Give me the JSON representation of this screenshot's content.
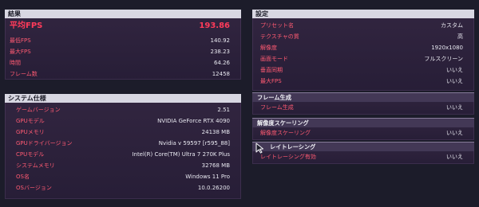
{
  "results": {
    "header": "結果",
    "avg_label": "平均FPS",
    "avg_value": "193.86",
    "rows": [
      {
        "label": "最低FPS",
        "value": "140.92"
      },
      {
        "label": "最大FPS",
        "value": "238.23"
      },
      {
        "label": "時間",
        "value": "64.26"
      },
      {
        "label": "フレーム数",
        "value": "12458"
      }
    ]
  },
  "system": {
    "header": "システム仕様",
    "rows": [
      {
        "label": "ゲームバージョン",
        "value": "2.51"
      },
      {
        "label": "GPUモデル",
        "value": "NVIDIA GeForce RTX 4090"
      },
      {
        "label": "GPUメモリ",
        "value": "24138 MB"
      },
      {
        "label": "GPUドライバージョン",
        "value": "Nvidia v 59597 [r595_88]"
      },
      {
        "label": "CPUモデル",
        "value": "Intel(R) Core(TM) Ultra 7 270K Plus"
      },
      {
        "label": "システムメモリ",
        "value": "32768 MB"
      },
      {
        "label": "OS名",
        "value": "Windows 11 Pro"
      },
      {
        "label": "OSバージョン",
        "value": "10.0.26200"
      }
    ]
  },
  "settings": {
    "header": "設定",
    "rows": [
      {
        "label": "プリセット名",
        "value": "カスタム"
      },
      {
        "label": "テクスチャの質",
        "value": "高"
      },
      {
        "label": "解像度",
        "value": "1920x1080"
      },
      {
        "label": "画面モード",
        "value": "フルスクリーン"
      },
      {
        "label": "垂直同期",
        "value": "いいえ"
      },
      {
        "label": "最大FPS",
        "value": "いいえ"
      }
    ],
    "frame_gen": {
      "header": "フレーム生成",
      "rows": [
        {
          "label": "フレーム生成",
          "value": "いいえ"
        }
      ]
    },
    "upscaling": {
      "header": "解像度スケーリング",
      "rows": [
        {
          "label": "解像度スケーリング",
          "value": "いいえ"
        }
      ]
    },
    "raytracing": {
      "header": "レイトレーシング",
      "rows": [
        {
          "label": "レイトレーシング有効",
          "value": "いいえ"
        }
      ]
    }
  },
  "colors": {
    "label": "#ff5a72",
    "value": "#e8e8f0",
    "header_bg": "#e6e6f0"
  },
  "icons": {
    "cursor": "mouse-pointer-icon"
  }
}
